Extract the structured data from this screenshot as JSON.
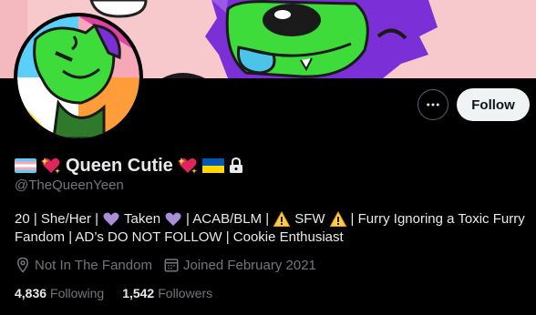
{
  "profile": {
    "display_name": "Queen Cutie",
    "handle": "@TheQueenYeen",
    "bio_line1_a": "20 | She/Her |",
    "bio_line1_b": "Taken",
    "bio_line1_c": "| ACAB/BLM |",
    "bio_line1_d": "SFW",
    "bio_line1_e": "| Furry Ignoring a Toxic Furry",
    "bio_line2": "Fandom | AD’s DO NOT FOLLOW | Cookie Enthusiast",
    "location": "Not In The Fandom",
    "joined": "Joined February 2021"
  },
  "stats": {
    "following_count": "4,836",
    "following_label": "Following",
    "followers_count": "1,542",
    "followers_label": "Followers"
  },
  "actions": {
    "follow_label": "Follow"
  },
  "icons": {
    "more": "more-horizontal-icon",
    "location": "location-pin-icon",
    "calendar": "calendar-icon",
    "lock": "lock-icon"
  },
  "colors": {
    "background": "#000000",
    "banner": "#f7c8cc",
    "secondary_text": "#71767b",
    "follow_button_bg": "#eff3f4"
  }
}
